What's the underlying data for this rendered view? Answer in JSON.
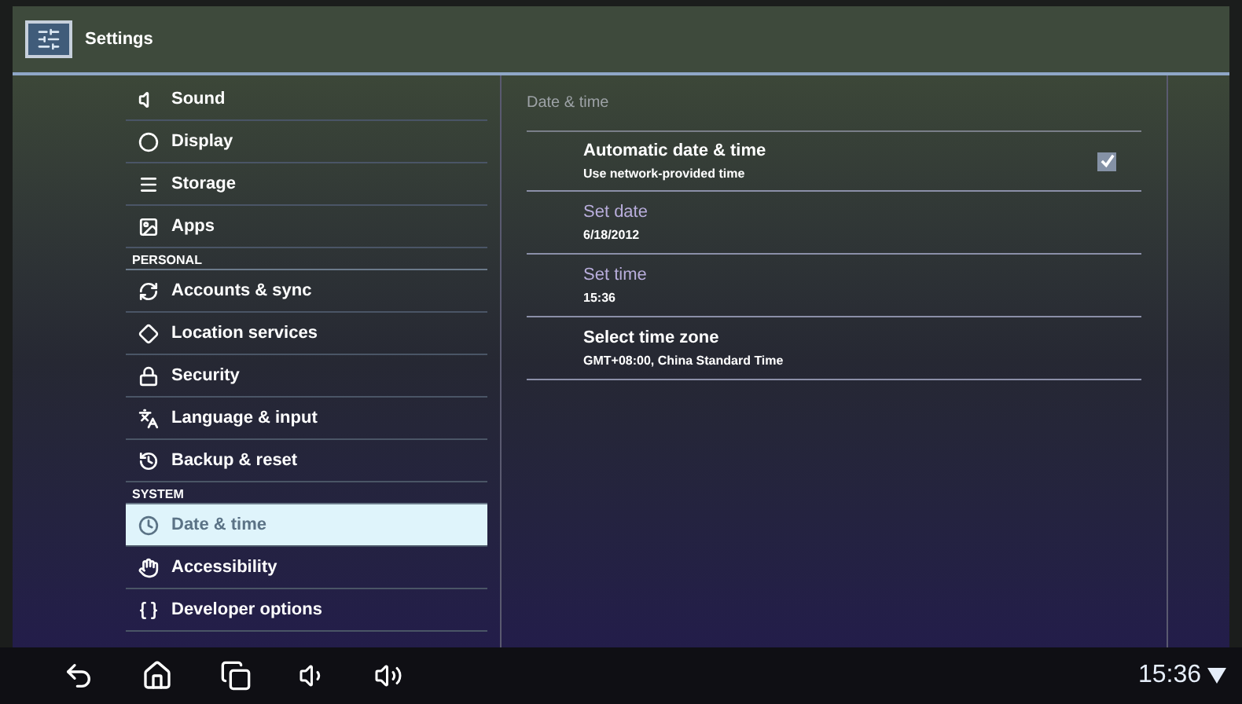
{
  "action_bar": {
    "title": "Settings"
  },
  "sidebar": {
    "items": [
      {
        "kind": "item",
        "label": "Sound",
        "selected": false
      },
      {
        "kind": "item",
        "label": "Display",
        "selected": false
      },
      {
        "kind": "item",
        "label": "Storage",
        "selected": false
      },
      {
        "kind": "item",
        "label": "Apps",
        "selected": false
      },
      {
        "kind": "header",
        "label": "PERSONAL"
      },
      {
        "kind": "item",
        "label": "Accounts & sync",
        "selected": false
      },
      {
        "kind": "item",
        "label": "Location services",
        "selected": false
      },
      {
        "kind": "item",
        "label": "Security",
        "selected": false
      },
      {
        "kind": "item",
        "label": "Language & input",
        "selected": false
      },
      {
        "kind": "item",
        "label": "Backup & reset",
        "selected": false
      },
      {
        "kind": "header",
        "label": "SYSTEM"
      },
      {
        "kind": "item",
        "label": "Date & time",
        "selected": true
      },
      {
        "kind": "item",
        "label": "Accessibility",
        "selected": false
      },
      {
        "kind": "item",
        "label": "Developer options",
        "selected": false
      }
    ]
  },
  "content": {
    "heading": "Date & time",
    "settings": [
      {
        "kind": "checkbox",
        "title": "Automatic date & time",
        "summary": "Use network-provided time",
        "checked": true,
        "disabled": false
      },
      {
        "kind": "plain",
        "title": "Set date",
        "summary": "6/18/2012",
        "disabled": true
      },
      {
        "kind": "plain",
        "title": "Set time",
        "summary": "15:36",
        "disabled": true
      },
      {
        "kind": "plain",
        "title": "Select time zone",
        "summary": "GMT+08:00, China Standard Time",
        "disabled": false
      }
    ]
  },
  "navigation_bar": {
    "clock": "15:36"
  }
}
